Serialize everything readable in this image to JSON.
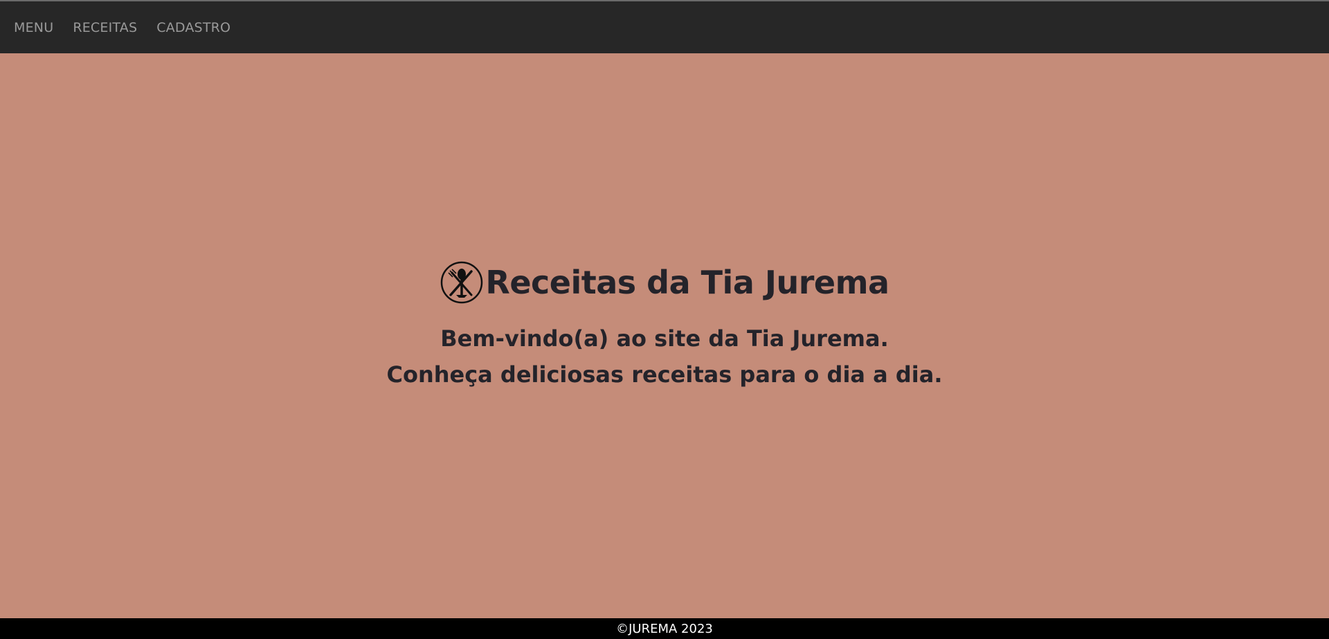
{
  "nav": {
    "items": [
      {
        "label": "MENU"
      },
      {
        "label": "RECEITAS"
      },
      {
        "label": "CADASTRO"
      }
    ]
  },
  "hero": {
    "logo_icon": "fork-spoon-knife-icon",
    "title": "Receitas da Tia Jurema",
    "subtitle_line1": "Bem-vindo(a) ao site da Tia Jurema.",
    "subtitle_line2": "Conheça deliciosas receitas para o dia a dia."
  },
  "footer": {
    "text": "©JUREMA 2023"
  },
  "colors": {
    "navbar_bg": "#272727",
    "nav_text": "#9a9a9a",
    "page_bg": "#c58c79",
    "text_dark": "#24232a",
    "footer_bg": "#000000"
  }
}
